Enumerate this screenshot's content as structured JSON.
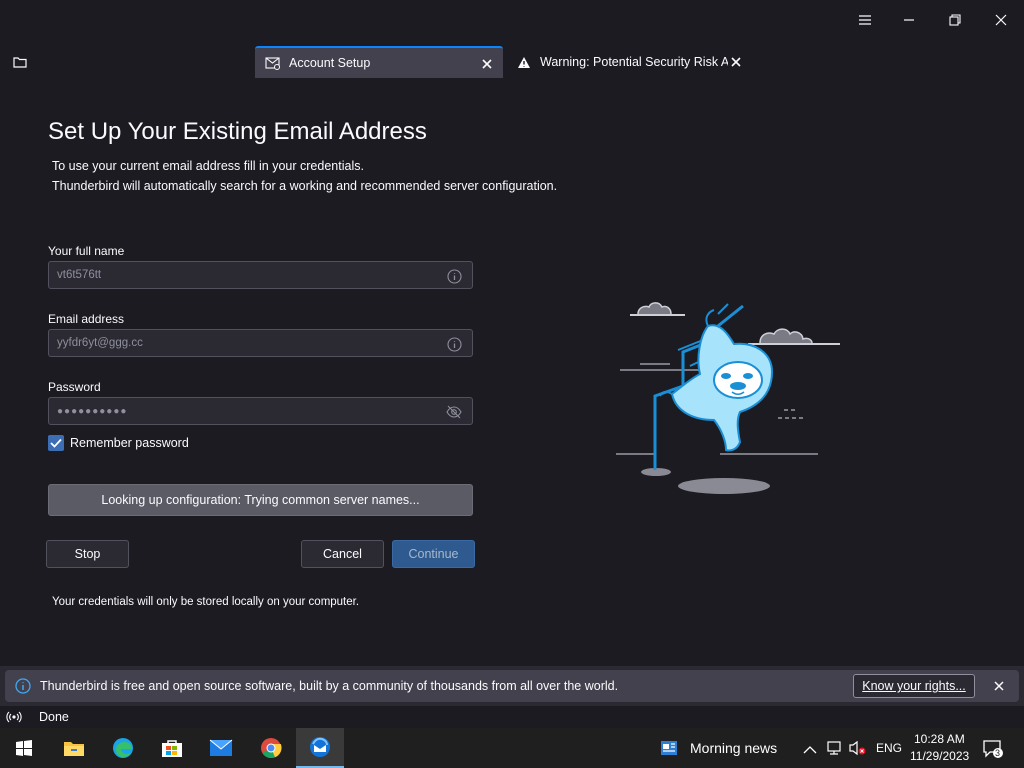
{
  "window": {
    "tabs": [
      {
        "label": "Account Setup",
        "icon": "mail-settings-icon",
        "active": true
      },
      {
        "label": "Warning: Potential Security Risk Ahe",
        "icon": "warning-icon",
        "active": false
      }
    ]
  },
  "page": {
    "title": "Set Up Your Existing Email Address",
    "desc_line1": "To use your current email address fill in your credentials.",
    "desc_line2": "Thunderbird will automatically search for a working and recommended server configuration.",
    "full_name_label": "Your full name",
    "full_name_value": "vt6t576tt",
    "email_label": "Email address",
    "email_value": "yyfdr6yt@ggg.cc",
    "password_label": "Password",
    "password_value": "●●●●●●●●●●",
    "remember_label": "Remember password",
    "remember_checked": true,
    "lookup_status": "Looking up configuration: Trying common server names...",
    "stop_label": "Stop",
    "cancel_label": "Cancel",
    "continue_label": "Continue",
    "note": "Your credentials will only be stored locally on your computer."
  },
  "notification": {
    "text": "Thunderbird is free and open source software, built by a community of thousands from all over the world.",
    "button": "Know your rights..."
  },
  "status": {
    "text": "Done"
  },
  "taskbar": {
    "apps": [
      "start-icon",
      "file-explorer-icon",
      "edge-icon",
      "store-icon",
      "mail-icon",
      "chrome-icon",
      "thunderbird-icon"
    ],
    "news": "Morning news",
    "lang": "ENG",
    "time": "10:28 AM",
    "date": "11/29/2023",
    "notif_count": "3"
  },
  "colors": {
    "accent": "#0a84ff",
    "background": "#1c1b22",
    "primary_button": "#2f5a8f",
    "illustration": "#7fd4f5"
  }
}
